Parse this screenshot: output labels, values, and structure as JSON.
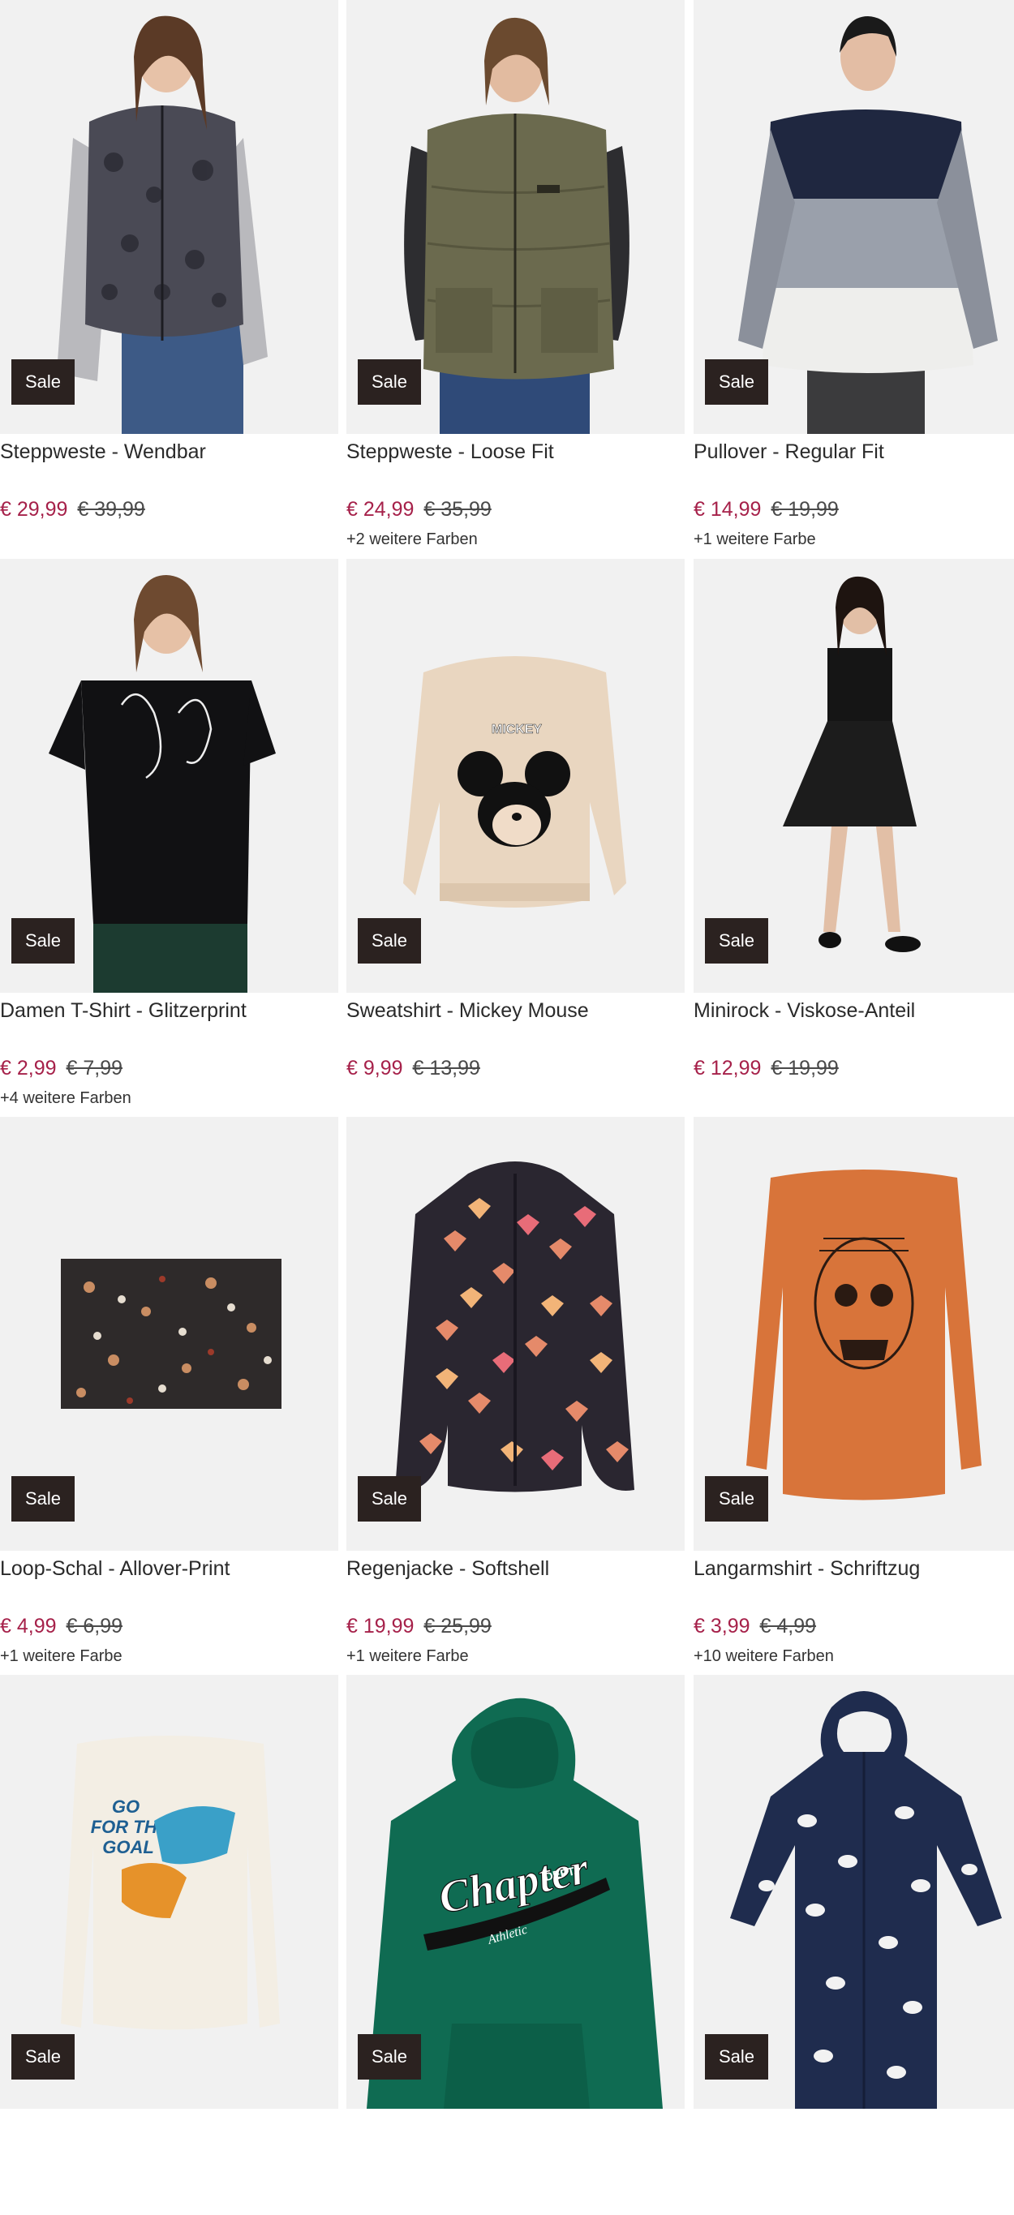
{
  "badge_label": "Sale",
  "colors": {
    "sale_price": "#a6214a",
    "badge_bg": "#2b2220",
    "image_bg": "#f1f1f1"
  },
  "products": [
    {
      "title": "Steppweste - Wendbar",
      "price": "€ 29,99",
      "old_price": "€ 39,99",
      "colors_text": "",
      "image": "woman-leopard-puffer-vest"
    },
    {
      "title": "Steppweste - Loose Fit",
      "price": "€ 24,99",
      "old_price": "€ 35,99",
      "colors_text": "+2 weitere Farben",
      "image": "man-olive-puffer-vest"
    },
    {
      "title": "Pullover - Regular Fit",
      "price": "€ 14,99",
      "old_price": "€ 19,99",
      "colors_text": "+1 weitere Farbe",
      "image": "man-colorblock-sweater"
    },
    {
      "title": "Damen T-Shirt - Glitzerprint",
      "price": "€ 2,99",
      "old_price": "€ 7,99",
      "colors_text": "+4 weitere Farben",
      "image": "woman-black-tshirt"
    },
    {
      "title": "Sweatshirt - Mickey Mouse",
      "price": "€ 9,99",
      "old_price": "€ 13,99",
      "colors_text": "",
      "image": "beige-mickey-sweatshirt"
    },
    {
      "title": "Minirock - Viskose-Anteil",
      "price": "€ 12,99",
      "old_price": "€ 19,99",
      "colors_text": "",
      "image": "woman-black-mini-skirt"
    },
    {
      "title": "Loop-Schal - Allover-Print",
      "price": "€ 4,99",
      "old_price": "€ 6,99",
      "colors_text": "+1 weitere Farbe",
      "image": "dark-floral-scarf"
    },
    {
      "title": "Regenjacke - Softshell",
      "price": "€ 19,99",
      "old_price": "€ 25,99",
      "colors_text": "+1 weitere Farbe",
      "image": "heart-print-softshell-jacket"
    },
    {
      "title": "Langarmshirt - Schriftzug",
      "price": "€ 3,99",
      "old_price": "€ 4,99",
      "colors_text": "+10 weitere Farben",
      "image": "orange-longsleeve-skull"
    },
    {
      "title": "",
      "price": "",
      "old_price": "",
      "colors_text": "",
      "image": "white-longsleeve-go-for-the-goal"
    },
    {
      "title": "",
      "price": "",
      "old_price": "",
      "colors_text": "",
      "image": "green-hoodie-chapter"
    },
    {
      "title": "",
      "price": "",
      "old_price": "",
      "colors_text": "",
      "image": "navy-dalmatian-onesie"
    }
  ],
  "print_texts": {
    "mickey": "MICKEY",
    "goal_line1": "GO",
    "goal_line2": "FOR THE",
    "goal_line3": "GOAL",
    "hoodie_script": "Chapter",
    "hoodie_dept": "DEPT.",
    "hoodie_sub": "Athletic"
  }
}
